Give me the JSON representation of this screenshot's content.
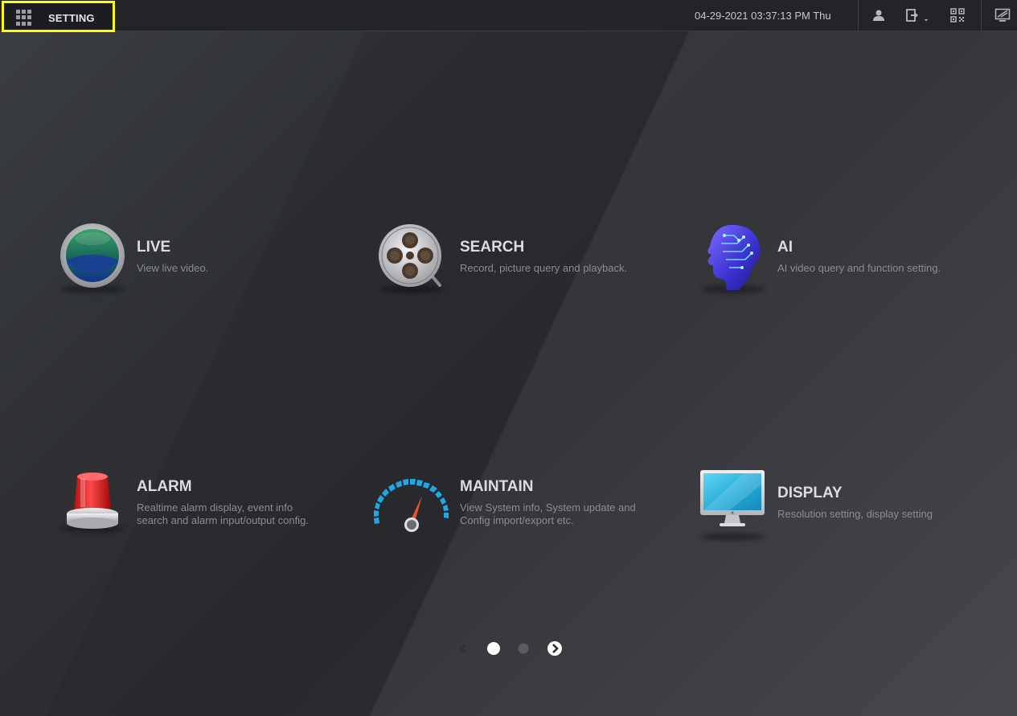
{
  "topbar": {
    "setting_label": "SETTING",
    "datetime": "04-29-2021 03:37:13 PM Thu",
    "icons": [
      "user-icon",
      "logout-icon",
      "qr-code-icon",
      "display-switch-icon"
    ]
  },
  "tiles": [
    {
      "title": "LIVE",
      "description": "View live video."
    },
    {
      "title": "SEARCH",
      "description": "Record, picture query and playback."
    },
    {
      "title": "AI",
      "description": "AI video query and function setting."
    },
    {
      "title": "ALARM",
      "description_line1": "Realtime alarm display, event info",
      "description_line2": "search and alarm input/output config."
    },
    {
      "title": "MAINTAIN",
      "description_line1": "View System info, System update and",
      "description_line2": "Config import/export etc."
    },
    {
      "title": "DISPLAY",
      "description": "Resolution setting, display setting"
    }
  ],
  "pagination": {
    "current_page": 1,
    "total_pages": 2
  },
  "colors": {
    "highlight": "#ffff00",
    "topbar": "#222427",
    "title_text": "#dcdcdc",
    "desc_text": "#8a8c90"
  }
}
